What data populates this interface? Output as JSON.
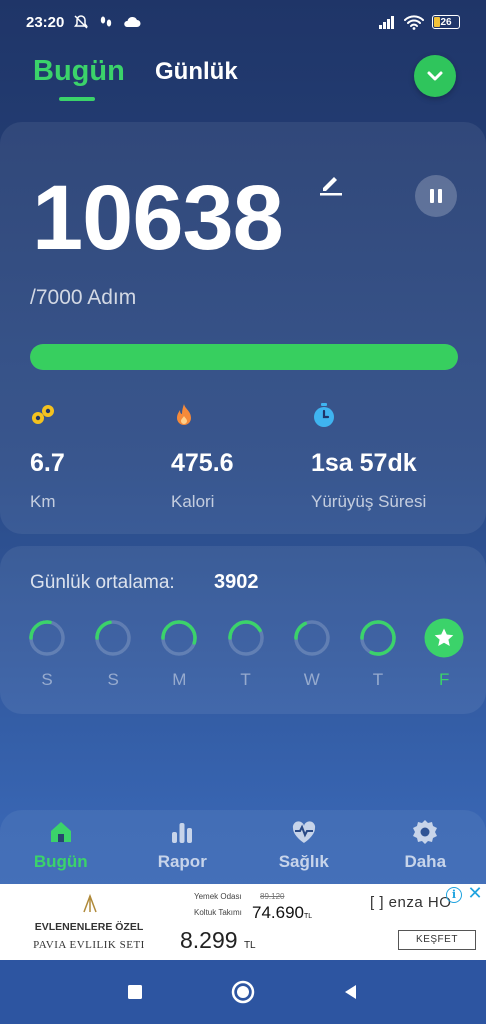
{
  "status_bar": {
    "time": "23:20",
    "battery": "26",
    "icons": [
      "silent-bell-icon",
      "footsteps-icon",
      "cloud-icon",
      "signal-icon",
      "wifi-icon",
      "battery-icon"
    ]
  },
  "header": {
    "tabs": [
      {
        "label": "Bugün",
        "active": true
      },
      {
        "label": "Günlük",
        "active": false
      }
    ],
    "action_icon": "check-icon"
  },
  "summary": {
    "steps": "10638",
    "goal_text": "/7000 Adım",
    "progress_fraction": 1.0,
    "stats": [
      {
        "icon": "distance-icon",
        "value": "6.7",
        "label": "Km"
      },
      {
        "icon": "flame-icon",
        "value": "475.6",
        "label": "Kalori"
      },
      {
        "icon": "stopwatch-icon",
        "value": "1sa 57dk",
        "label": "Yürüyüş Süresi"
      }
    ]
  },
  "weekly": {
    "label": "Günlük ortalama:",
    "value": "3902",
    "days": [
      {
        "letter": "S",
        "fraction": 0.28
      },
      {
        "letter": "S",
        "fraction": 0.22
      },
      {
        "letter": "M",
        "fraction": 0.55
      },
      {
        "letter": "T",
        "fraction": 0.42
      },
      {
        "letter": "W",
        "fraction": 0.18
      },
      {
        "letter": "T",
        "fraction": 0.82
      },
      {
        "letter": "F",
        "fraction": 1.0,
        "today": true,
        "goal_reached": true
      }
    ],
    "colors": {
      "accent": "#3bd36a",
      "track": "rgba(255,255,255,0.18)"
    }
  },
  "bottom_nav": [
    {
      "label": "Bugün",
      "icon": "home-icon",
      "active": true
    },
    {
      "label": "Rapor",
      "icon": "bar-chart-icon",
      "active": false
    },
    {
      "label": "Sağlık",
      "icon": "heart-pulse-icon",
      "active": false
    },
    {
      "label": "Daha",
      "icon": "gear-icon",
      "active": false
    }
  ],
  "ad": {
    "left_line1": "EVLENENLERE ÖZEL",
    "left_line2": "PAVIA EVLILIK SETI",
    "label_1": "Yemek Odası",
    "old_price": "89.120",
    "label_2": "Koltuk Takımı",
    "new_price": "74.690",
    "new_price_unit": "TL",
    "big_price": "8.299",
    "big_price_unit": "TL",
    "brand": "[ ] enza HO",
    "cta": "KEŞFET"
  },
  "theme": {
    "accent": "#3bd36a",
    "background_top": "#1f3568",
    "background_bottom": "#3d6dbb"
  }
}
